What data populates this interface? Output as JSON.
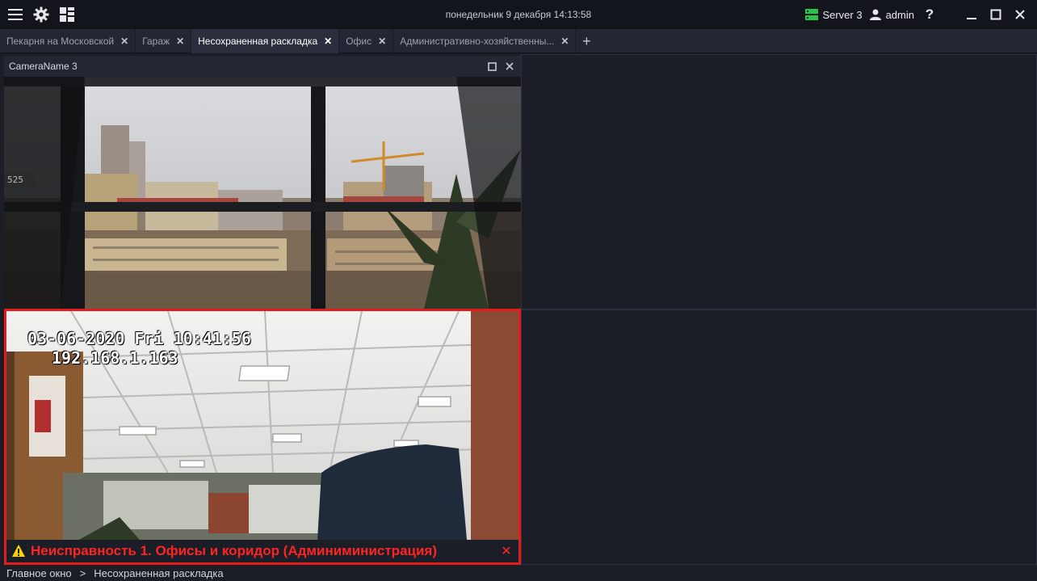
{
  "titlebar": {
    "datetime": "понедельник 9 декабря 14:13:58",
    "server_label": "Server 3",
    "user_label": "admin"
  },
  "tabs": [
    {
      "label": "Пекарня на Московской",
      "active": false
    },
    {
      "label": "Гараж",
      "active": false
    },
    {
      "label": "Несохраненная раскладка",
      "active": true
    },
    {
      "label": "Офис",
      "active": false
    },
    {
      "label": "Административно-хозяйственны...",
      "active": false
    }
  ],
  "cameras": {
    "cam1": {
      "title": "CameraName 3"
    },
    "cam2": {
      "osd_datetime": "03-06-2020 Fri 10:41:56",
      "osd_ip": "192.168.1.163",
      "alarm_text": "Неисправность  1. Офисы и коридор (Админиминистрация)"
    }
  },
  "breadcrumb": {
    "root": "Главное окно",
    "separator": ">",
    "current": "Несохраненная раскладка"
  },
  "colors": {
    "accent_alarm": "#e21b1b",
    "server_ok": "#29c44a",
    "warning": "#ffd400"
  }
}
